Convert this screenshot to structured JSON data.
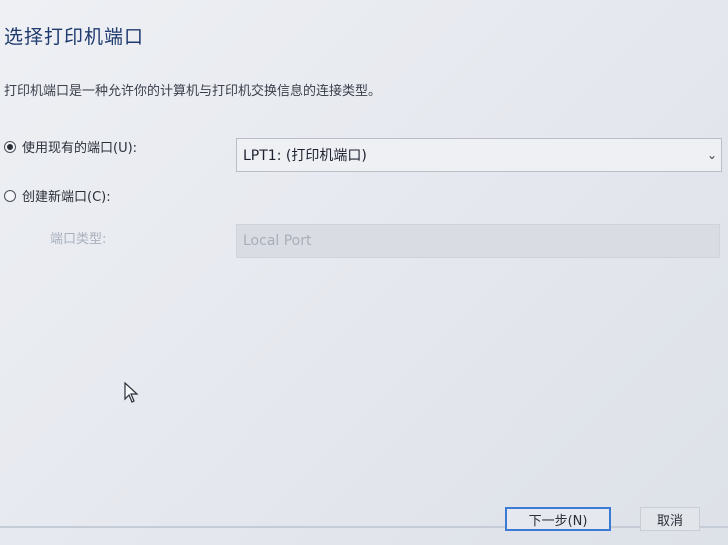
{
  "dialog": {
    "title": "选择打印机端口",
    "description": "打印机端口是一种允许你的计算机与打印机交换信息的连接类型。"
  },
  "use_existing": {
    "label": "使用现有的端口(U):",
    "selected": true,
    "port_value": "LPT1: (打印机端口)"
  },
  "create_new": {
    "label": "创建新端口(C):",
    "selected": false,
    "type_label": "端口类型:",
    "type_value": "Local Port"
  },
  "buttons": {
    "next": "下一步(N)",
    "cancel": "取消"
  }
}
